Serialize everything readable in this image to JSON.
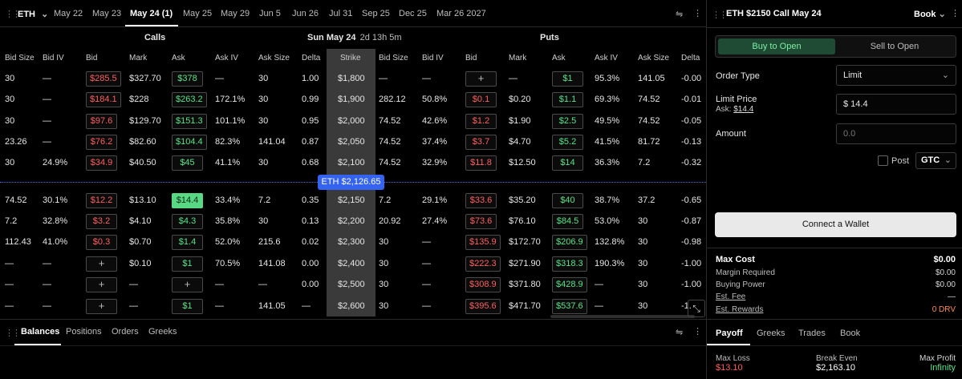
{
  "colors": {
    "bid": "#ff5f5f",
    "ask": "#57e389",
    "accent": "#3463f0",
    "tab_active_bg": "#1f4a33"
  },
  "top": {
    "asset": "ETH",
    "expiries": [
      "May 22",
      "May 23",
      "May 24 (1)",
      "May 25",
      "May 29",
      "Jun 5",
      "Jun 26",
      "Jul 31",
      "Sep 25",
      "Dec 25",
      "Mar 26 2027"
    ],
    "active_expiry": "May 24 (1)"
  },
  "chain": {
    "calls_label": "Calls",
    "puts_label": "Puts",
    "date_label": "Sun May 24",
    "countdown": "2d 13h 5m",
    "call_columns": [
      "Bid Size",
      "Bid IV",
      "Bid",
      "Mark",
      "Ask",
      "Ask IV",
      "Ask Size",
      "Delta"
    ],
    "strike_column": "Strike",
    "put_columns": [
      "Bid Size",
      "Bid IV",
      "Bid",
      "Mark",
      "Ask",
      "Ask IV",
      "Ask Size",
      "Delta"
    ],
    "spot_label": "ETH $2,126.65",
    "rows": [
      {
        "c": [
          "30",
          "—",
          "$285.5",
          "$327.70",
          "$378",
          "—",
          "30",
          "1.00"
        ],
        "strike": "$1,800",
        "p": [
          "—",
          "—",
          "+",
          "—",
          "$1",
          "95.3%",
          "141.05",
          "-0.00"
        ]
      },
      {
        "c": [
          "30",
          "—",
          "$184.1",
          "$228",
          "$263.2",
          "172.1%",
          "30",
          "0.99"
        ],
        "strike": "$1,900",
        "p": [
          "282.12",
          "50.8%",
          "$0.1",
          "$0.20",
          "$1.1",
          "69.3%",
          "74.52",
          "-0.01"
        ]
      },
      {
        "c": [
          "30",
          "—",
          "$97.6",
          "$129.70",
          "$151.3",
          "101.1%",
          "30",
          "0.95"
        ],
        "strike": "$2,000",
        "p": [
          "74.52",
          "42.6%",
          "$1.2",
          "$1.90",
          "$2.5",
          "49.5%",
          "74.52",
          "-0.05"
        ]
      },
      {
        "c": [
          "23.26",
          "—",
          "$76.2",
          "$82.60",
          "$104.4",
          "82.3%",
          "141.04",
          "0.87"
        ],
        "strike": "$2,050",
        "p": [
          "74.52",
          "37.4%",
          "$3.7",
          "$4.70",
          "$5.2",
          "41.5%",
          "81.72",
          "-0.13"
        ]
      },
      {
        "c": [
          "30",
          "24.9%",
          "$34.9",
          "$40.50",
          "$45",
          "41.1%",
          "30",
          "0.68"
        ],
        "strike": "$2,100",
        "p": [
          "74.52",
          "32.9%",
          "$11.8",
          "$12.50",
          "$14",
          "36.3%",
          "7.2",
          "-0.32"
        ]
      },
      {
        "c": [
          "74.52",
          "30.1%",
          "$12.2",
          "$13.10",
          "$14.4",
          "33.4%",
          "7.2",
          "0.35"
        ],
        "strike": "$2,150",
        "p": [
          "7.2",
          "29.1%",
          "$33.6",
          "$35.20",
          "$40",
          "38.7%",
          "37.2",
          "-0.65"
        ]
      },
      {
        "c": [
          "7.2",
          "32.8%",
          "$3.2",
          "$4.10",
          "$4.3",
          "35.8%",
          "30",
          "0.13"
        ],
        "strike": "$2,200",
        "p": [
          "20.92",
          "27.4%",
          "$73.6",
          "$76.10",
          "$84.5",
          "53.0%",
          "30",
          "-0.87"
        ]
      },
      {
        "c": [
          "112.43",
          "41.0%",
          "$0.3",
          "$0.70",
          "$1.4",
          "52.0%",
          "215.6",
          "0.02"
        ],
        "strike": "$2,300",
        "p": [
          "30",
          "—",
          "$135.9",
          "$172.70",
          "$206.9",
          "132.8%",
          "30",
          "-0.98"
        ]
      },
      {
        "c": [
          "—",
          "—",
          "+",
          "$0.10",
          "$1",
          "70.5%",
          "141.08",
          "0.00"
        ],
        "strike": "$2,400",
        "p": [
          "30",
          "—",
          "$222.3",
          "$271.90",
          "$318.3",
          "190.3%",
          "30",
          "-1.00"
        ]
      },
      {
        "c": [
          "—",
          "—",
          "+",
          "—",
          "+",
          "—",
          "—",
          "0.00"
        ],
        "strike": "$2,500",
        "p": [
          "30",
          "—",
          "$308.9",
          "$371.80",
          "$428.9",
          "—",
          "30",
          "-1.00"
        ]
      },
      {
        "c": [
          "—",
          "—",
          "+",
          "—",
          "$1",
          "—",
          "141.05",
          "—"
        ],
        "strike": "$2,600",
        "p": [
          "30",
          "—",
          "$395.6",
          "$471.70",
          "$537.6",
          "—",
          "30",
          "-1."
        ]
      }
    ]
  },
  "bottom_tabs": [
    "Balances",
    "Positions",
    "Orders",
    "Greeks"
  ],
  "ticket": {
    "title": "ETH $2150 Call May 24",
    "book_label": "Book",
    "buy_label": "Buy to Open",
    "sell_label": "Sell to Open",
    "order_type_label": "Order Type",
    "order_type_value": "Limit",
    "limit_price_label": "Limit Price",
    "ask_hint_prefix": "Ask:",
    "ask_hint_value": "$14.4",
    "limit_price_value": "$ 14.4",
    "amount_label": "Amount",
    "amount_placeholder": "0.0",
    "post_label": "Post",
    "tif_value": "GTC",
    "connect_label": "Connect a Wallet",
    "max_cost_label": "Max Cost",
    "max_cost_value": "$0.00",
    "margin_label": "Margin Required",
    "margin_value": "$0.00",
    "buying_power_label": "Buying Power",
    "buying_power_value": "$0.00",
    "fee_label": "Est. Fee",
    "fee_value": "—",
    "rewards_label": "Est. Rewards",
    "rewards_value": "0 DRV",
    "tabs": [
      "Payoff",
      "Greeks",
      "Trades",
      "Book"
    ],
    "max_loss_label": "Max Loss",
    "max_loss_value": "$13.10",
    "break_even_label": "Break Even",
    "break_even_value": "$2,163.10",
    "max_profit_label": "Max Profit",
    "max_profit_value": "Infinity"
  }
}
